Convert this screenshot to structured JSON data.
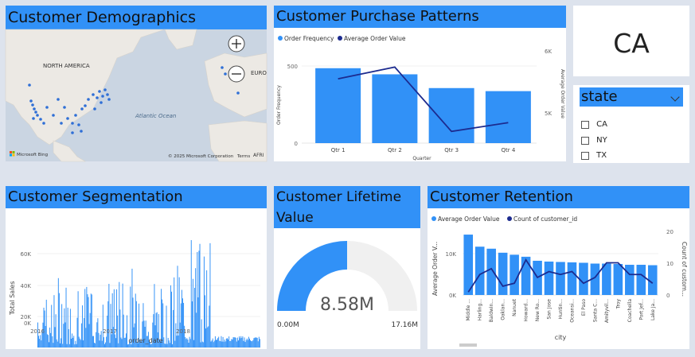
{
  "colors": {
    "accent": "#3191f7",
    "line": "#1c2b8f",
    "background": "#dde3ed"
  },
  "demographics": {
    "title": "Customer Demographics",
    "labels": {
      "north_america": "NORTH AMERICA",
      "europe": "EURO",
      "ocean": "Atlantic Ocean",
      "africa": "AFRI"
    },
    "copyright": "© 2025 Microsoft Corporation",
    "terms": "Terms",
    "bing": "Microsoft Bing",
    "zoom_in_icon": "plus-icon",
    "zoom_out_icon": "minus-icon"
  },
  "purchase": {
    "title": "Customer Purchase Patterns",
    "legend": [
      "Order Frequency",
      "Average Order Value"
    ],
    "y_ticks": [
      "500",
      "0"
    ],
    "y2_ticks": [
      "6K",
      "5K"
    ],
    "ylabel": "Order Frequency",
    "y2label": "Average Order Value",
    "xlabel": "Quarter",
    "chart_data": {
      "type": "bar",
      "categories": [
        "Qtr 1",
        "Qtr 2",
        "Qtr 3",
        "Qtr 4"
      ],
      "series": [
        {
          "name": "Order Frequency",
          "type": "bar",
          "values": [
            490,
            450,
            360,
            340
          ]
        },
        {
          "name": "Average Order Value",
          "type": "line",
          "values": [
            5700,
            5900,
            4800,
            4950
          ]
        }
      ],
      "ylim": [
        0,
        650
      ],
      "y2lim": [
        4600,
        6300
      ]
    }
  },
  "kpi": {
    "value": "CA"
  },
  "slicer": {
    "title": "state",
    "chevron_icon": "chevron-down-icon",
    "options": [
      {
        "label": "CA"
      },
      {
        "label": "NY"
      },
      {
        "label": "TX"
      }
    ]
  },
  "segmentation": {
    "title": "Customer Segmentation",
    "ylabel": "Total Sales",
    "xlabel": "order_date",
    "y_ticks": [
      "60K",
      "40K",
      "20K",
      "0K"
    ],
    "x_ticks": [
      "2016",
      "2017",
      "2018"
    ],
    "chart_data": {
      "type": "bar",
      "x_range": [
        "2016-01-01",
        "2018-12-31"
      ],
      "ylim": [
        0,
        70000
      ],
      "peak_values": {
        "2016": 40000,
        "2017": 45000,
        "2018": 68000
      }
    }
  },
  "lifetime": {
    "title": "Customer Lifetime Value",
    "value": "8.58M",
    "min": "0.00M",
    "max": "17.16M",
    "chart_data": {
      "type": "gauge",
      "value": 8.58,
      "min": 0,
      "max": 17.16
    }
  },
  "retention": {
    "title": "Customer Retention",
    "legend": [
      "Average Order Value",
      "Count of customer_id"
    ],
    "ylabel": "Average Order V...",
    "y2label": "Count of custom...",
    "xlabel": "city",
    "y_ticks": [
      "10K",
      "0K"
    ],
    "y2_ticks": [
      "20",
      "10",
      "0"
    ],
    "chart_data": {
      "type": "bar",
      "categories": [
        "Middle ...",
        "Harling...",
        "Baldwin...",
        "Oaklan...",
        "Nanuet",
        "Howard...",
        "New Ro...",
        "San Jose",
        "Huntin...",
        "Oceansi...",
        "El Paso",
        "Santa C...",
        "Amityvil...",
        "Troy",
        "Coachella",
        "Port Jef...",
        "Lake Ja..."
      ],
      "series": [
        {
          "name": "Average Order Value",
          "type": "bar",
          "values": [
            15000,
            12000,
            11500,
            10500,
            10000,
            9500,
            8500,
            8300,
            8200,
            8100,
            8000,
            7800,
            7800,
            7700,
            7500,
            7500,
            7400
          ]
        },
        {
          "name": "Count of customer_id",
          "type": "line",
          "values": [
            1,
            7,
            9,
            3,
            4,
            12,
            6,
            8,
            7,
            8,
            4,
            6,
            11,
            11,
            7,
            7,
            4
          ]
        }
      ],
      "ylim": [
        0,
        16000
      ],
      "y2lim": [
        0,
        22
      ]
    }
  }
}
